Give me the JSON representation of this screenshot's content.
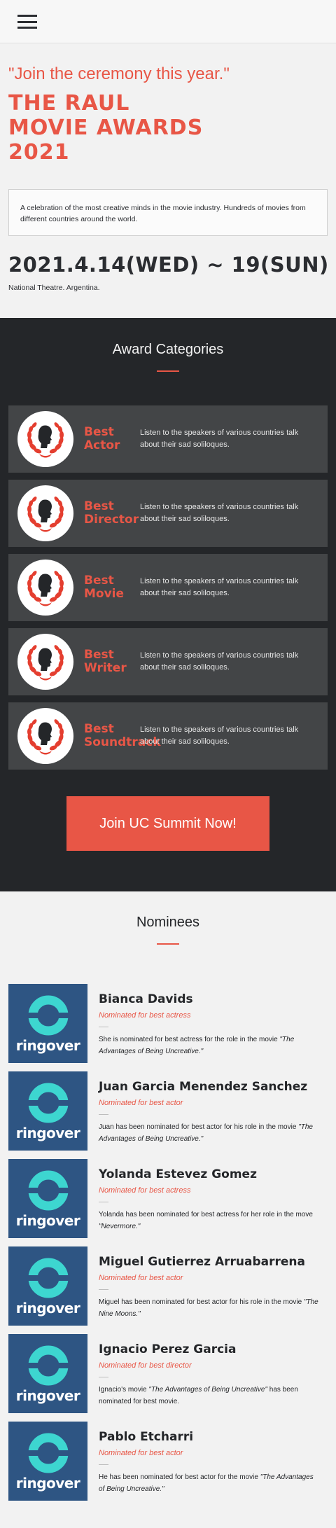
{
  "header": {
    "menu_icon": "hamburger-menu-icon"
  },
  "hero": {
    "quote": "\"Join the ceremony this year.\"",
    "title_lines": [
      "THE RAUL",
      "MOVIE AWARDS",
      "2021"
    ],
    "description": "A celebration of the most creative minds in the movie industry. Hundreds of movies from different countries around the world.",
    "date": "2021.4.14(WED) ~ 19(SUN)",
    "venue": "National Theatre. Argentina."
  },
  "awards": {
    "title": "Award Categories",
    "icon": "laurel-silhouette-icon",
    "items": [
      {
        "name_line1": "Best",
        "name_line2": "Actor",
        "desc": "Listen to the speakers of various countries talk about their sad soliloques."
      },
      {
        "name_line1": "Best",
        "name_line2": "Director",
        "desc": "Listen to the speakers of various countries talk about their sad soliloques."
      },
      {
        "name_line1": "Best",
        "name_line2": "Movie",
        "desc": "Listen to the speakers of various countries talk about their sad soliloques."
      },
      {
        "name_line1": "Best",
        "name_line2": "Writer",
        "desc": "Listen to the speakers of various countries talk about their sad soliloques."
      },
      {
        "name_line1": "Best",
        "name_line2": "Soundtrack",
        "desc": "Listen to the speakers of various countries talk about their sad soliloques."
      }
    ],
    "cta_label": "Join UC Summit Now!"
  },
  "nominees": {
    "title": "Nominees",
    "brand": "ringover",
    "items": [
      {
        "name": "Bianca Davids",
        "role": "Nominated for best actress",
        "text_before": "She is nominated for best actress for the role in the movie ",
        "movie": "\"The Advantages of Being Uncreative.\"",
        "text_after": ""
      },
      {
        "name": "Juan Garcia Menendez Sanchez",
        "role": "Nominated for best actor",
        "text_before": "Juan has been nominated for best actor for his role in the movie ",
        "movie": "\"The Advantages of Being Uncreative.\"",
        "text_after": ""
      },
      {
        "name": "Yolanda Estevez Gomez",
        "role": "Nominated for best actress",
        "text_before": "Yolanda has been nominated for best actress for her role in the move ",
        "movie": "\"Nevermore.\"",
        "text_after": ""
      },
      {
        "name": "Miguel Gutierrez Arruabarrena",
        "role": "Nominated for best actor",
        "text_before": "Miguel has been nominated for best actor for his role in the movie ",
        "movie": "\"The Nine Moons.\"",
        "text_after": ""
      },
      {
        "name": "Ignacio Perez Garcia",
        "role": "Nominated for best director",
        "text_before": "Ignacio's movie ",
        "movie": "\"The Advantages of Being Uncreative\"",
        "text_after": " has been nominated for best movie."
      },
      {
        "name": "Pablo Etcharri",
        "role": "Nominated for best actor",
        "text_before": "He has been nominated for best actor for the movie ",
        "movie": "\"The Advantages of Being Uncreative.\"",
        "text_after": ""
      }
    ]
  },
  "colors": {
    "accent": "#e85646",
    "dark": "#242629",
    "card": "#434547",
    "logo_bg": "#2e5583",
    "logo_ring": "#3dd6d0"
  }
}
